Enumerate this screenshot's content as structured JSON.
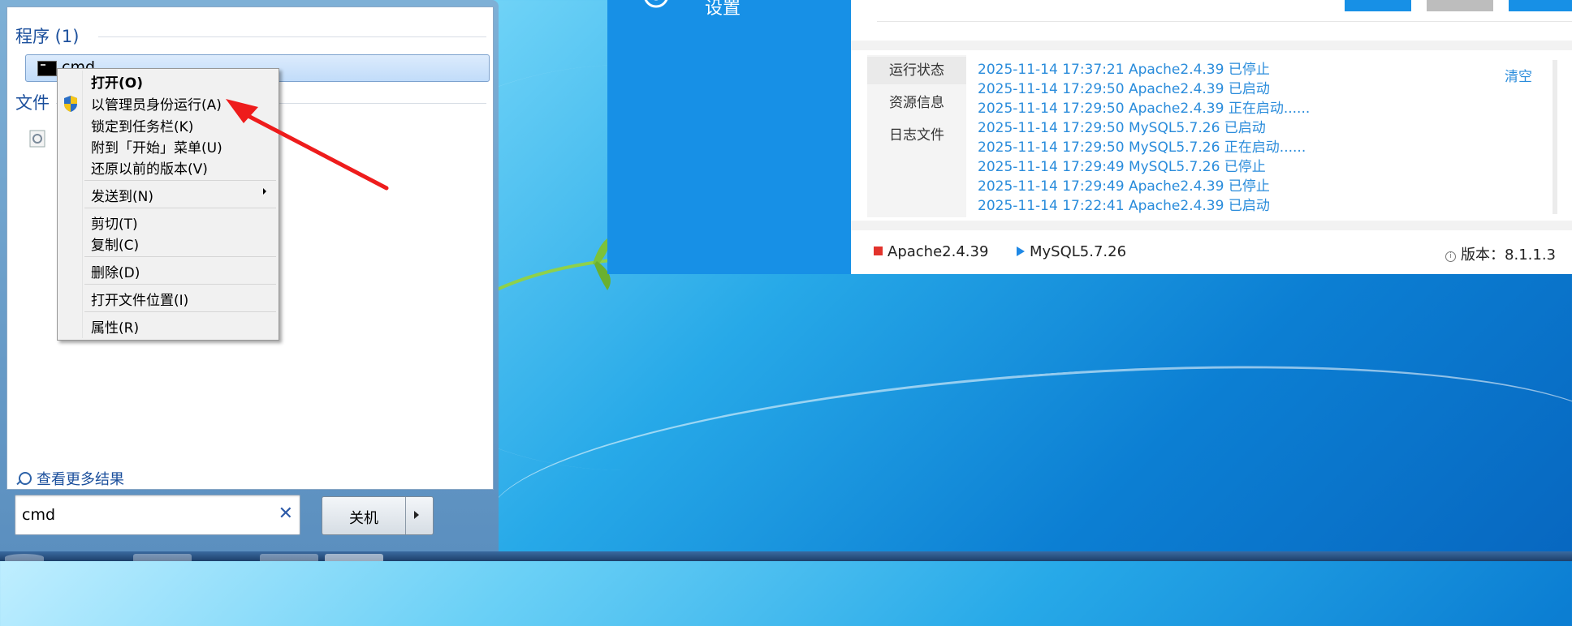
{
  "app": {
    "settings_label": "设置",
    "log_tabs": [
      "运行状态",
      "资源信息",
      "日志文件"
    ],
    "clear_label": "清空",
    "log_lines": [
      "2025-11-14 17:37:21 Apache2.4.39 已停止",
      "2025-11-14 17:29:50 Apache2.4.39 已启动",
      "2025-11-14 17:29:50 Apache2.4.39 正在启动......",
      "2025-11-14 17:29:50 MySQL5.7.26 已启动",
      "2025-11-14 17:29:50 MySQL5.7.26 正在启动......",
      "2025-11-14 17:29:49 MySQL5.7.26 已停止",
      "2025-11-14 17:29:49 Apache2.4.39 已停止",
      "2025-11-14 17:22:41 Apache2.4.39 已启动"
    ],
    "status": {
      "apache": "Apache2.4.39",
      "mysql": "MySQL5.7.26",
      "version": "版本：8.1.1.3"
    },
    "colors": {
      "blue_panel": "#1790e6",
      "log_text": "#2a8cdb",
      "stopped": "#e2332c",
      "running": "#1e88e5"
    }
  },
  "start_menu": {
    "programs_header": "程序 (1)",
    "program_item": "cmd",
    "files_header": "文件",
    "more_results": "查看更多结果",
    "search_value": "cmd",
    "shutdown_label": "关机"
  },
  "context_menu": {
    "items": [
      "打开(O)",
      "以管理员身份运行(A)",
      "锁定到任务栏(K)",
      "附到「开始」菜单(U)",
      "还原以前的版本(V)",
      "发送到(N)",
      "剪切(T)",
      "复制(C)",
      "删除(D)",
      "打开文件位置(I)",
      "属性(R)"
    ]
  }
}
